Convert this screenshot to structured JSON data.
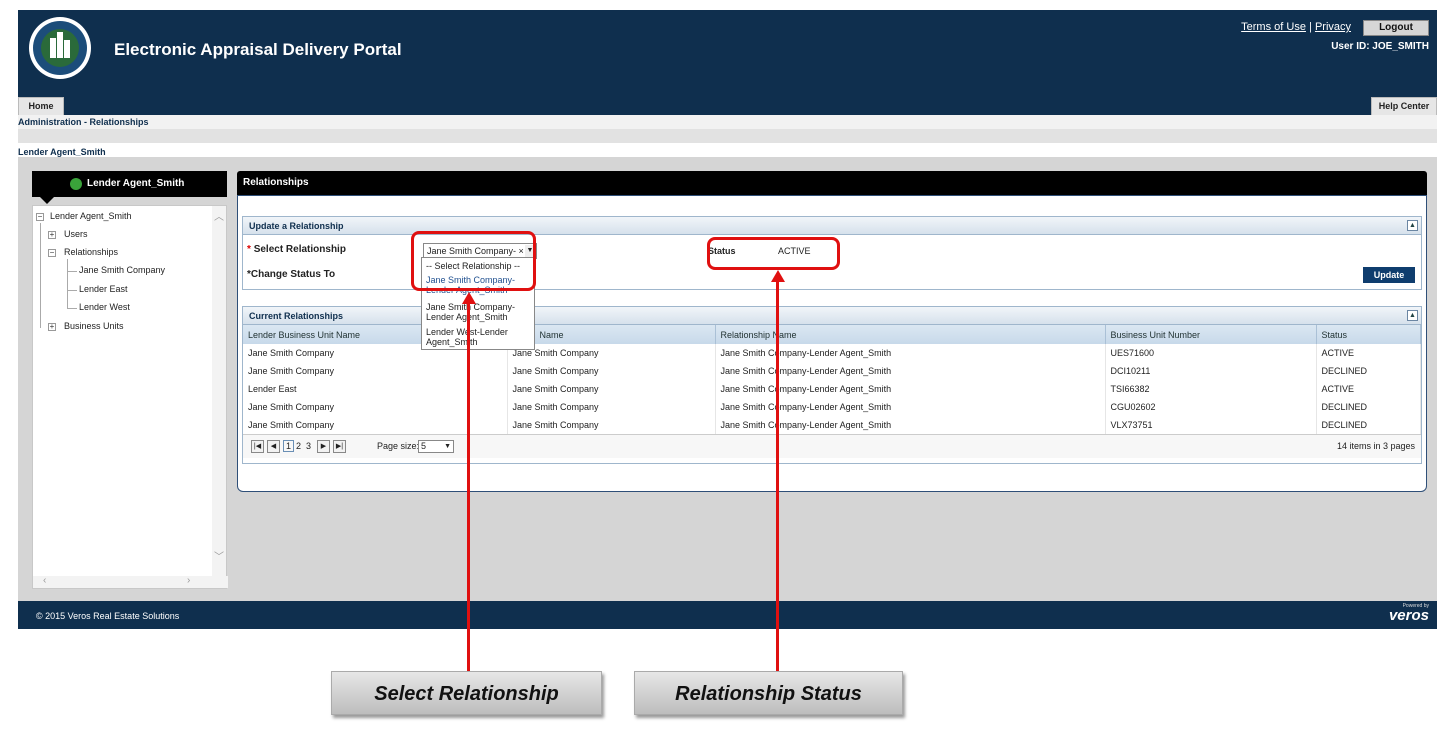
{
  "header": {
    "app_title": "Electronic Appraisal Delivery Portal",
    "terms_link": "Terms of Use",
    "separator": "|",
    "privacy_link": "Privacy",
    "logout_label": "Logout",
    "user_id": "User ID: JOE_SMITH"
  },
  "nav": {
    "home_tab": "Home",
    "help_center": "Help Center"
  },
  "breadcrumb": "Administration - Relationships",
  "lender_heading": "Lender Agent_Smith",
  "left_panel": {
    "title": "Lender Agent_Smith",
    "tree": {
      "root": "Lender Agent_Smith",
      "users": "Users",
      "relationships": "Relationships",
      "rel_children": [
        "Jane Smith Company",
        "Lender East",
        "Lender West"
      ],
      "business_units": "Business Units"
    }
  },
  "relationships_panel": {
    "title": "Relationships",
    "update_section": {
      "title": "Update a Relationship",
      "select_label": "Select Relationship",
      "required_mark": "*",
      "selected_value": "Jane Smith Company- ×",
      "change_status_label": "*Change Status To",
      "status_label": "Status",
      "status_value": "ACTIVE",
      "update_button": "Update"
    },
    "dropdown_options": [
      "-- Select Relationship --",
      "Jane Smith Company-Lender Agent_Smith",
      "Jane Smith Company-Lender Agent_Smith",
      "Lender West-Lender Agent_Smith"
    ],
    "current_section": {
      "title": "Current Relationships",
      "columns": [
        "Lender Business Unit Name",
        "Name",
        "Relationship Name",
        "Business Unit Number",
        "Status"
      ],
      "rows": [
        [
          "Jane Smith Company",
          "Jane Smith Company",
          "Jane Smith Company-Lender Agent_Smith",
          "UES71600",
          "ACTIVE"
        ],
        [
          "Jane Smith Company",
          "Jane Smith Company",
          "Jane Smith Company-Lender Agent_Smith",
          "DCI10211",
          "DECLINED"
        ],
        [
          "Lender East",
          "Jane Smith Company",
          "Jane Smith Company-Lender Agent_Smith",
          "TSI66382",
          "ACTIVE"
        ],
        [
          "Jane Smith Company",
          "Jane Smith Company",
          "Jane Smith Company-Lender Agent_Smith",
          "CGU02602",
          "DECLINED"
        ],
        [
          "Jane Smith Company",
          "Jane Smith Company",
          "Jane Smith Company-Lender Agent_Smith",
          "VLX73751",
          "DECLINED"
        ]
      ],
      "pager": {
        "pages": [
          "1",
          "2",
          "3"
        ],
        "page_size_label": "Page size:",
        "page_size": "5",
        "items_text": "14 items in 3 pages"
      }
    }
  },
  "footer": {
    "copyright": "© 2015 Veros Real Estate Solutions",
    "brand": "veros",
    "powered": "Powered by"
  },
  "callouts": {
    "select": "Select Relationship",
    "status": "Relationship Status"
  },
  "colors": {
    "header_bg": "#0f2f4e",
    "highlight_red": "#e01010",
    "update_button": "#0f3d6e"
  }
}
